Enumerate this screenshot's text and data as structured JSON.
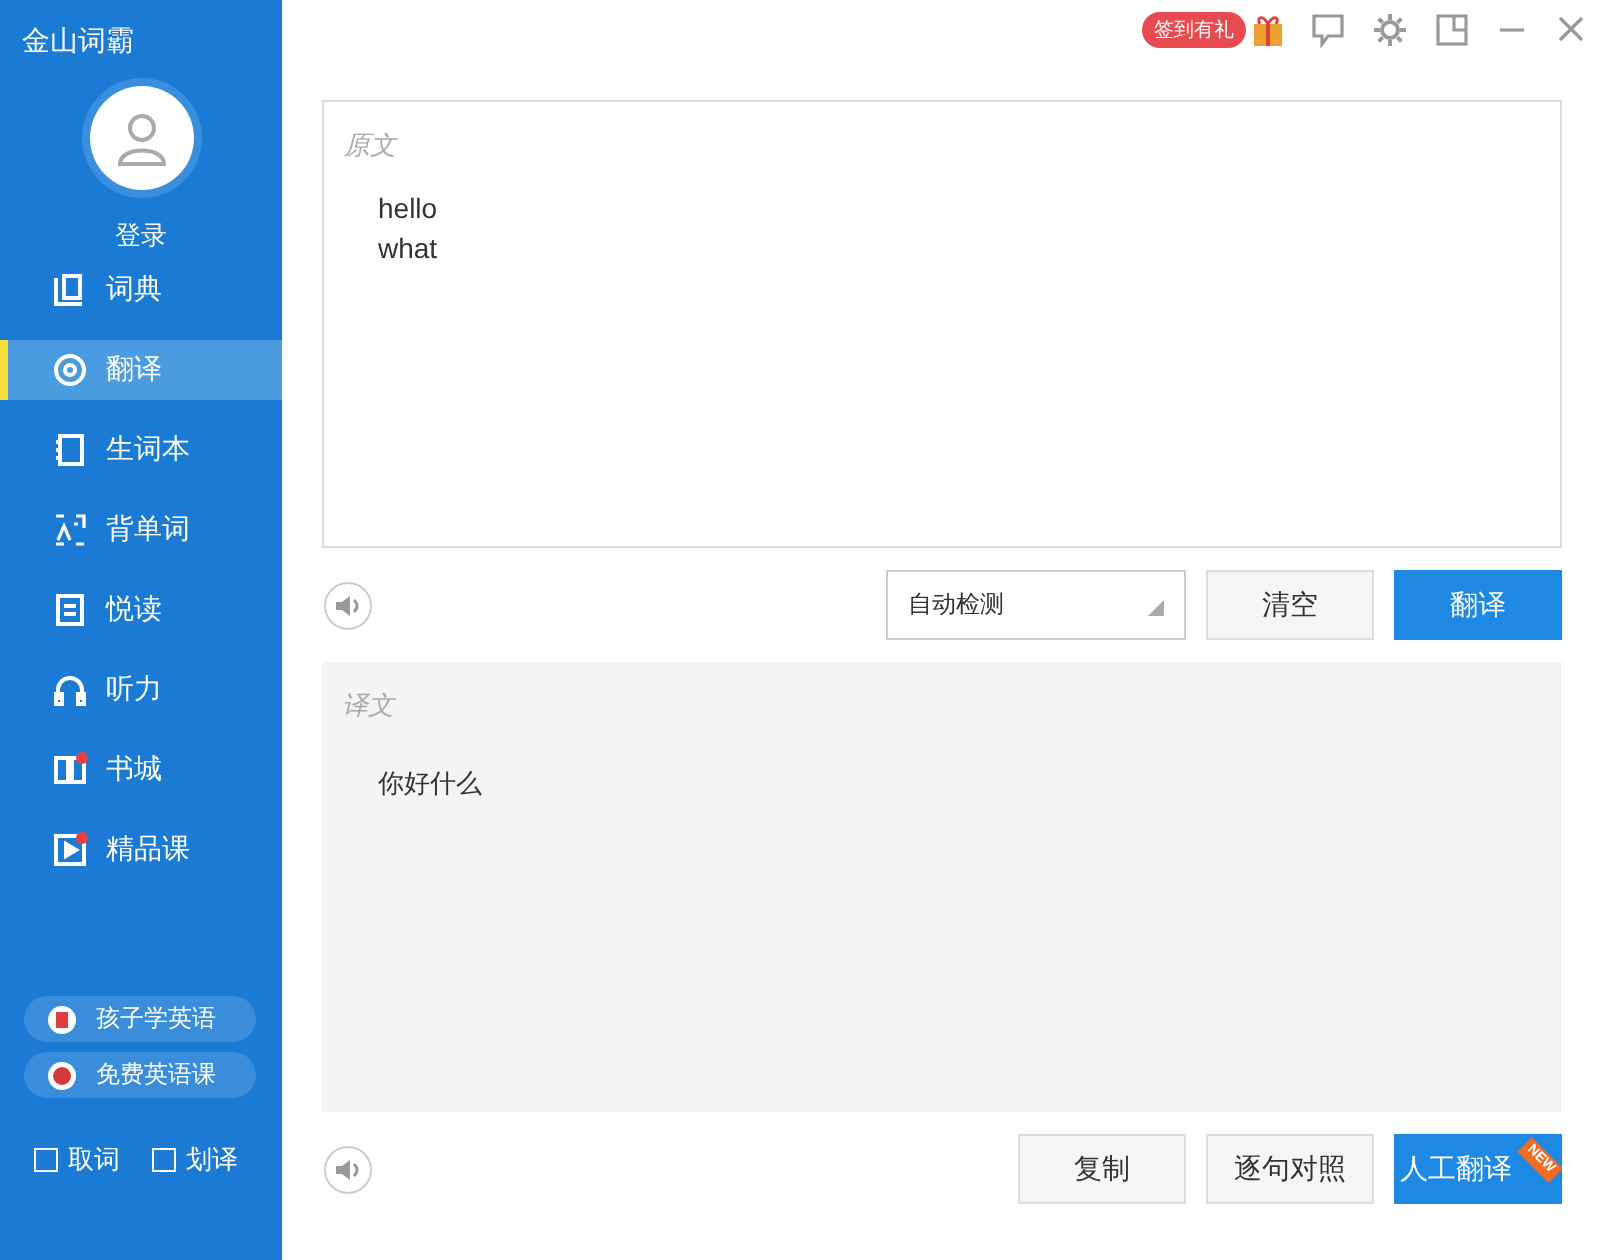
{
  "app_title": "金山词霸",
  "login": "登录",
  "nav": [
    {
      "label": "词典",
      "selected": false,
      "badge": false
    },
    {
      "label": "翻译",
      "selected": true,
      "badge": false
    },
    {
      "label": "生词本",
      "selected": false,
      "badge": false
    },
    {
      "label": "背单词",
      "selected": false,
      "badge": false
    },
    {
      "label": "悦读",
      "selected": false,
      "badge": false
    },
    {
      "label": "听力",
      "selected": false,
      "badge": false
    },
    {
      "label": "书城",
      "selected": false,
      "badge": true
    },
    {
      "label": "精品课",
      "selected": false,
      "badge": true
    }
  ],
  "promos": [
    {
      "label": "孩子学英语"
    },
    {
      "label": "免费英语课"
    }
  ],
  "options": [
    {
      "label": "取词",
      "checked": false
    },
    {
      "label": "划译",
      "checked": false
    }
  ],
  "topbar": {
    "checkin": "签到有礼"
  },
  "source": {
    "label": "原文",
    "lines": [
      "hello",
      "what"
    ]
  },
  "language_select": "自动检测",
  "clear_button": "清空",
  "translate_button": "翻译",
  "result": {
    "label": "译文",
    "text": "你好什么"
  },
  "copy_button": "复制",
  "compare_button": "逐句对照",
  "human_button": {
    "label": "人工翻译",
    "ribbon": "NEW"
  }
}
